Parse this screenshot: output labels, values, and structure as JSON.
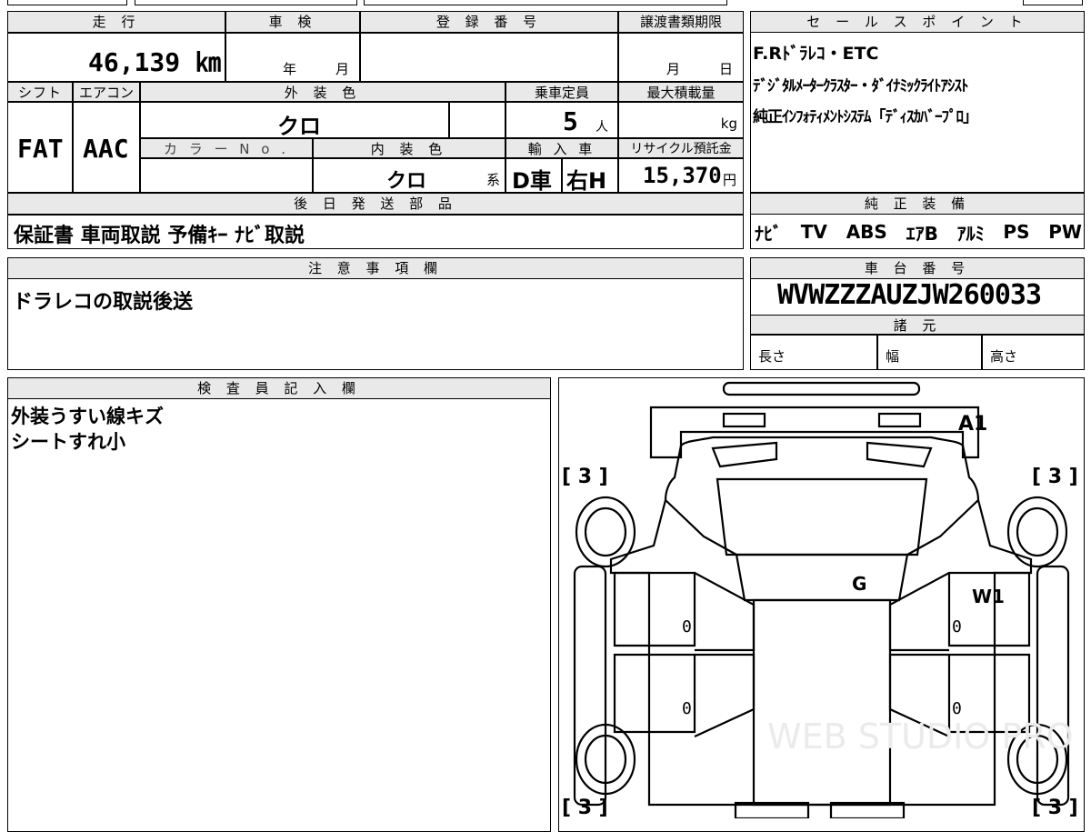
{
  "top": {
    "mileage_header": "走 行",
    "shaken_header": "車 検",
    "reg_header": "登 録 番 号",
    "transfer_header": "譲渡書類期限",
    "mileage_value": "46,139 ㎞",
    "shaken_year": "年",
    "shaken_month": "月",
    "transfer_month": "月",
    "transfer_day": "日"
  },
  "row2": {
    "shift_header": "シフト",
    "ac_header": "エアコン",
    "ext_color_header": "外 装 色",
    "capacity_header": "乗車定員",
    "max_load_header": "最大積載量",
    "shift_value": "FAT",
    "ac_value": "AAC",
    "ext_color_value": "クロ",
    "capacity_value": "5",
    "capacity_unit": "人",
    "load_unit": "kg",
    "color_no_header": "カ ラ ー N o .",
    "int_color_header": "内 装 色",
    "import_header": "輸 入 車",
    "recycle_header": "リサイクル預託金",
    "int_color_value": "クロ",
    "int_color_suffix": "系",
    "import_value1": "D車",
    "import_value2": "右H",
    "recycle_value": "15,370",
    "recycle_unit": "円"
  },
  "later_parts": {
    "header": "後 日 発 送 部 品",
    "value": "保証書 車両取説 予備ｷｰ ﾅﾋﾞ取説"
  },
  "sales_points": {
    "header": "セ ー ル ス ポ イ ン ト",
    "lines": [
      "F.Rﾄﾞﾗﾚｺ・ETC",
      "ﾃﾞｼﾞﾀﾙﾒｰﾀｰｸﾗｽﾀｰ・ﾀﾞｲﾅﾐｯｸﾗｲﾄｱｼｽﾄ",
      "純正ｲﾝﾌｫﾃｨﾒﾝﾄｼｽﾃﾑ「ﾃﾞｨｽｶﾊﾞｰﾌﾟﾛ」"
    ]
  },
  "equipment": {
    "header": "純 正 装 備",
    "items": [
      "ﾅﾋﾞ",
      "TV",
      "ABS",
      "ｴｱB",
      "ｱﾙﾐ",
      "PS",
      "PW"
    ]
  },
  "notes": {
    "header": "注 意 事 項 欄",
    "value": "ドラレコの取説後送"
  },
  "chassis": {
    "header": "車 台 番 号",
    "value": "WVWZZZAUZJW260033",
    "spec_header": "諸 元",
    "length_label": "長さ",
    "width_label": "幅",
    "height_label": "高さ"
  },
  "inspector": {
    "header": "検 査 員 記 入 欄",
    "lines": [
      "外装うすい線キズ",
      "シートすれ小"
    ]
  },
  "diagram": {
    "marks": {
      "front_right": "A1",
      "glass": "G",
      "right_door": "W1"
    },
    "tire_labels": {
      "fl": "[ 3 ]",
      "fr": "[ 3 ]",
      "rl": "[ 3 ]",
      "rr": "[ 3 ]"
    },
    "door_zeros": {
      "a": "0",
      "b": "0",
      "c": "0",
      "d": "0"
    },
    "watermark": "WEB STUDIO PRO"
  }
}
